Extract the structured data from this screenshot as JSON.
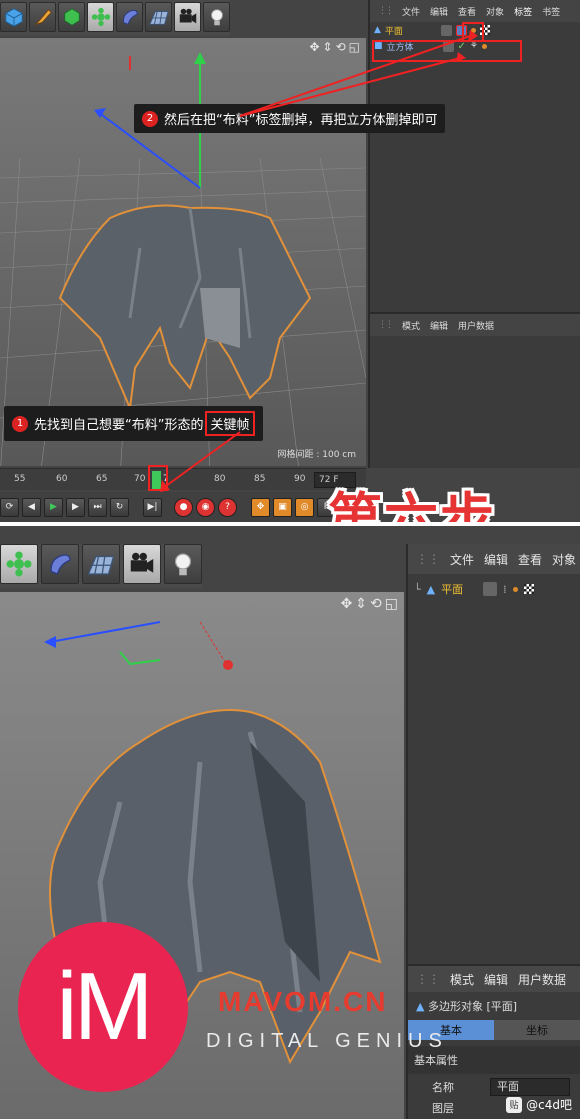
{
  "top": {
    "object_manager_menu": [
      "文件",
      "编辑",
      "查看",
      "对象",
      "标签",
      "书签"
    ],
    "objects": [
      {
        "name": "平面"
      },
      {
        "name": "立方体"
      }
    ],
    "attribute_menu": [
      "模式",
      "编辑",
      "用户数据"
    ],
    "timeline_ticks": [
      "55",
      "60",
      "65",
      "70",
      "75",
      "80",
      "85",
      "90"
    ],
    "current_frame_marker": "7",
    "frame_field": "72 F",
    "grid_info": "网格间距 : 100 cm",
    "callout_1": {
      "number": "1",
      "text_before": "先找到自己想要“布料”形态的",
      "text_boxed": "关键帧"
    },
    "callout_2": {
      "number": "2",
      "text": "然后在把“布料”标签删掉，再把立方体删掉即可"
    },
    "step_title": "第六步"
  },
  "bottom": {
    "object_manager_menu": [
      "文件",
      "编辑",
      "查看",
      "对象"
    ],
    "objects": [
      {
        "name": "平面"
      }
    ],
    "attribute_menu": [
      "模式",
      "编辑",
      "用户数据"
    ],
    "attribute_title": "多边形对象 [平面]",
    "attribute_tabs": [
      "基本",
      "坐标"
    ],
    "section_label": "基本属性",
    "field_name_label": "名称",
    "field_name_value": "平面",
    "field_layer_label": "图层"
  },
  "watermark": {
    "logo_text": "iM",
    "brand": "MAVOM.CN",
    "tagline": "DIGITAL GENIUS",
    "credit_badge": "贴",
    "credit_text": "@c4d吧"
  },
  "colors": {
    "callout_red": "#e22222",
    "title_red": "#e63434",
    "logo_pink": "#ea2450",
    "selection_orange": "#e08a2a",
    "tab_blue": "#5b8fd6"
  }
}
